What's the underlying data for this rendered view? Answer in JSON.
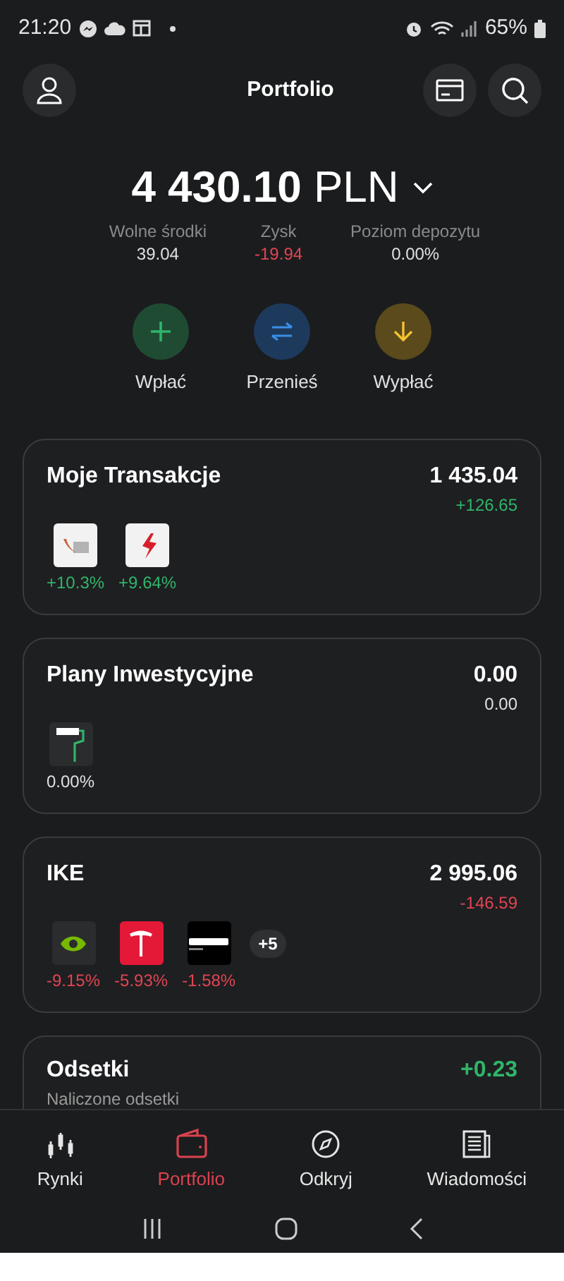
{
  "status_bar": {
    "time": "21:20",
    "battery": "65%"
  },
  "header": {
    "title": "Portfolio"
  },
  "total": {
    "amount": "4 430.10",
    "currency": "PLN"
  },
  "stats": [
    {
      "label": "Wolne środki",
      "value": "39.04",
      "color": "#e0e0e0"
    },
    {
      "label": "Zysk",
      "value": "-19.94",
      "color": "#e04552"
    },
    {
      "label": "Poziom depozytu",
      "value": "0.00%",
      "color": "#e0e0e0"
    }
  ],
  "actions": [
    {
      "label": "Wpłać",
      "kind": "deposit"
    },
    {
      "label": "Przenieś",
      "kind": "transfer"
    },
    {
      "label": "Wypłać",
      "kind": "withdraw"
    }
  ],
  "cards": [
    {
      "title": "Moje Transakcje",
      "value": "1 435.04",
      "change": "+126.65",
      "color": "#2fb56a",
      "holdings": [
        {
          "kind": "light",
          "change": "+10.3%",
          "color": "#2fb56a"
        },
        {
          "kind": "light-red",
          "change": "+9.64%",
          "color": "#2fb56a"
        }
      ]
    },
    {
      "title": "Plany Inwestycyjne",
      "value": "0.00",
      "change": "0.00",
      "color": "#e0e0e0",
      "holdings": [
        {
          "kind": "plan",
          "change": "0.00%",
          "color": "#e0e0e0"
        }
      ]
    },
    {
      "title": "IKE",
      "value": "2 995.06",
      "change": "-146.59",
      "color": "#e04552",
      "more": "+5",
      "holdings": [
        {
          "kind": "dark-green",
          "change": "-9.15%",
          "color": "#e04552"
        },
        {
          "kind": "red",
          "change": "-5.93%",
          "color": "#e04552"
        },
        {
          "kind": "black",
          "change": "-1.58%",
          "color": "#e04552"
        }
      ]
    }
  ],
  "interest": {
    "title": "Odsetki",
    "value": "+0.23",
    "color": "#2fb56a",
    "subtitle": "Naliczone odsetki"
  },
  "nav": [
    {
      "label": "Rynki",
      "kind": "markets",
      "selected": false
    },
    {
      "label": "Portfolio",
      "kind": "portfolio",
      "selected": true
    },
    {
      "label": "Odkryj",
      "kind": "discover",
      "selected": false
    },
    {
      "label": "Wiadomości",
      "kind": "news",
      "selected": false
    }
  ]
}
